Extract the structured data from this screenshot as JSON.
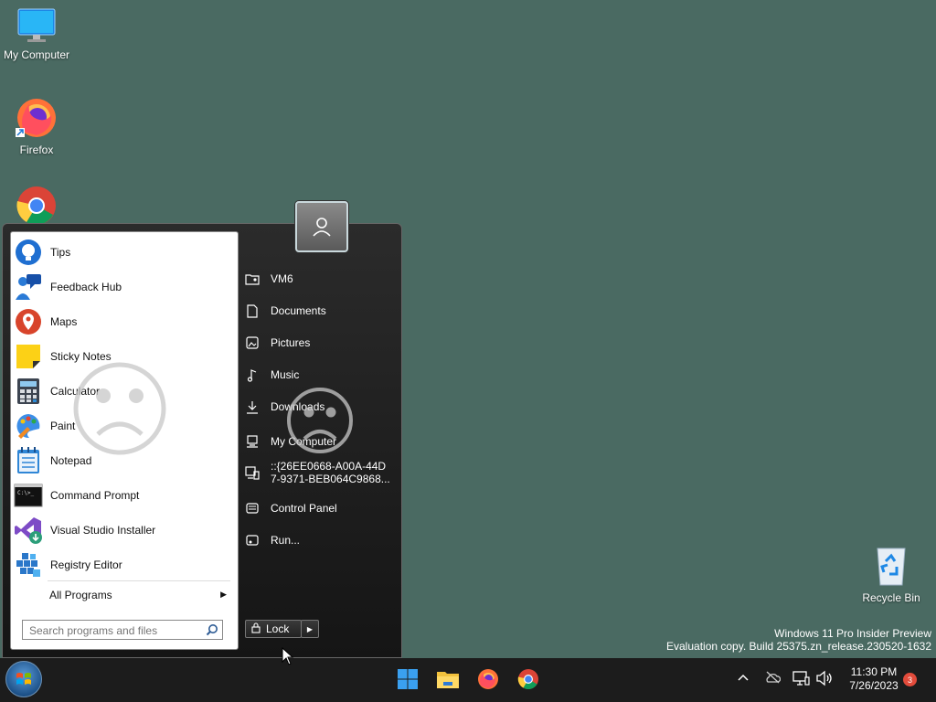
{
  "desktop": {
    "icons": [
      {
        "label": "My Computer",
        "icon": "monitor-icon"
      },
      {
        "label": "Firefox",
        "icon": "firefox-icon"
      },
      {
        "label": "Chrome",
        "icon": "chrome-icon"
      },
      {
        "label": "Recycle Bin",
        "icon": "recycle-bin-icon"
      }
    ]
  },
  "start_menu": {
    "programs": [
      {
        "label": "Tips",
        "icon": "tips-icon"
      },
      {
        "label": "Feedback Hub",
        "icon": "feedback-hub-icon"
      },
      {
        "label": "Maps",
        "icon": "maps-icon"
      },
      {
        "label": "Sticky Notes",
        "icon": "sticky-notes-icon"
      },
      {
        "label": "Calculator",
        "icon": "calculator-icon"
      },
      {
        "label": "Paint",
        "icon": "paint-icon"
      },
      {
        "label": "Notepad",
        "icon": "notepad-icon"
      },
      {
        "label": "Command Prompt",
        "icon": "command-prompt-icon"
      },
      {
        "label": "Visual Studio Installer",
        "icon": "visual-studio-installer-icon"
      },
      {
        "label": "Registry Editor",
        "icon": "registry-editor-icon"
      }
    ],
    "all_programs": "All Programs",
    "search_placeholder": "Search programs and files",
    "places": [
      {
        "label": "VM6",
        "icon": "user-folder-icon"
      },
      {
        "label": "Documents",
        "icon": "documents-icon"
      },
      {
        "label": "Pictures",
        "icon": "pictures-icon"
      },
      {
        "label": "Music",
        "icon": "music-icon"
      },
      {
        "label": "Downloads",
        "icon": "downloads-icon"
      },
      {
        "label": "My Computer",
        "icon": "computer-icon"
      },
      {
        "label_line1": "::{26EE0668-A00A-44D",
        "label_line2": "7-9371-BEB064C9868...",
        "icon": "remote-icon"
      },
      {
        "label": "Control Panel",
        "icon": "control-panel-icon"
      },
      {
        "label": "Run...",
        "icon": "run-icon"
      }
    ],
    "lock_label": "Lock"
  },
  "watermark": {
    "line1": "Windows 11 Pro Insider Preview",
    "line2": "Evaluation copy. Build 25375.zn_release.230520-1632"
  },
  "taskbar": {
    "clock_time": "11:30 PM",
    "clock_date": "7/26/2023",
    "notification_count": "3",
    "pinned": [
      "windows-start-icon",
      "file-explorer-icon",
      "firefox-icon",
      "chrome-icon"
    ]
  },
  "colors": {
    "desktop_bg": "#4a6a62",
    "taskbar_bg": "#1c1c1c",
    "notification_badge": "#e24b3b"
  }
}
